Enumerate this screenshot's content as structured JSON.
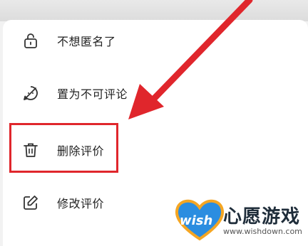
{
  "menu": {
    "items": [
      {
        "label": "不想匿名了",
        "icon": "lock-icon"
      },
      {
        "label": "置为不可评论",
        "icon": "no-comment-icon"
      },
      {
        "label": "删除评价",
        "icon": "trash-icon"
      },
      {
        "label": "修改评价",
        "icon": "edit-icon"
      }
    ]
  },
  "annotation": {
    "highlight_color": "#e0262c",
    "arrow_color": "#e0262c"
  },
  "watermark": {
    "brand": "心愿游戏",
    "logo_text": "wish",
    "url": "www.wishdown.com",
    "logo_colors": {
      "heart_fill": "#2b8de0",
      "heart_outline": "#f5a623"
    }
  }
}
